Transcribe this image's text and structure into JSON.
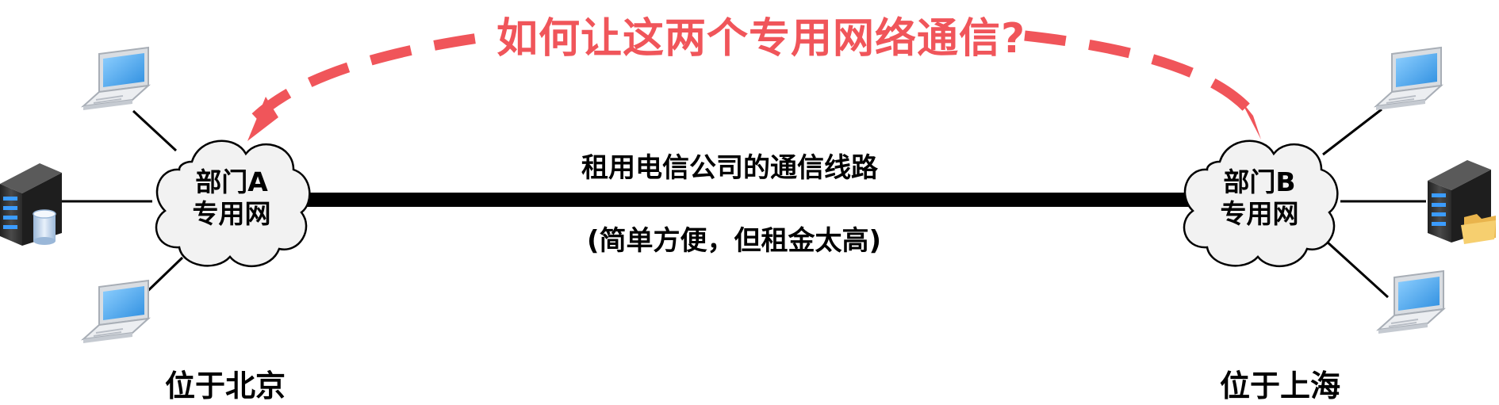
{
  "question": "如何让这两个专用网络通信?",
  "link": {
    "label": "租用电信公司的通信线路",
    "note": "(简单方便，但租金太高)"
  },
  "site_a": {
    "network_line1": "部门A",
    "network_line2": "专用网",
    "location": "位于北京"
  },
  "site_b": {
    "network_line1": "部门B",
    "network_line2": "专用网",
    "location": "位于上海"
  },
  "colors": {
    "accent": "#f0555a",
    "line": "#000000",
    "cloud_fill": "#f2f2f2",
    "laptop_screen": "#5aaeea",
    "server_body": "#3a3a3a"
  },
  "icons": [
    "laptop-icon",
    "server-icon",
    "database-icon",
    "folder-icon",
    "cloud-icon"
  ]
}
